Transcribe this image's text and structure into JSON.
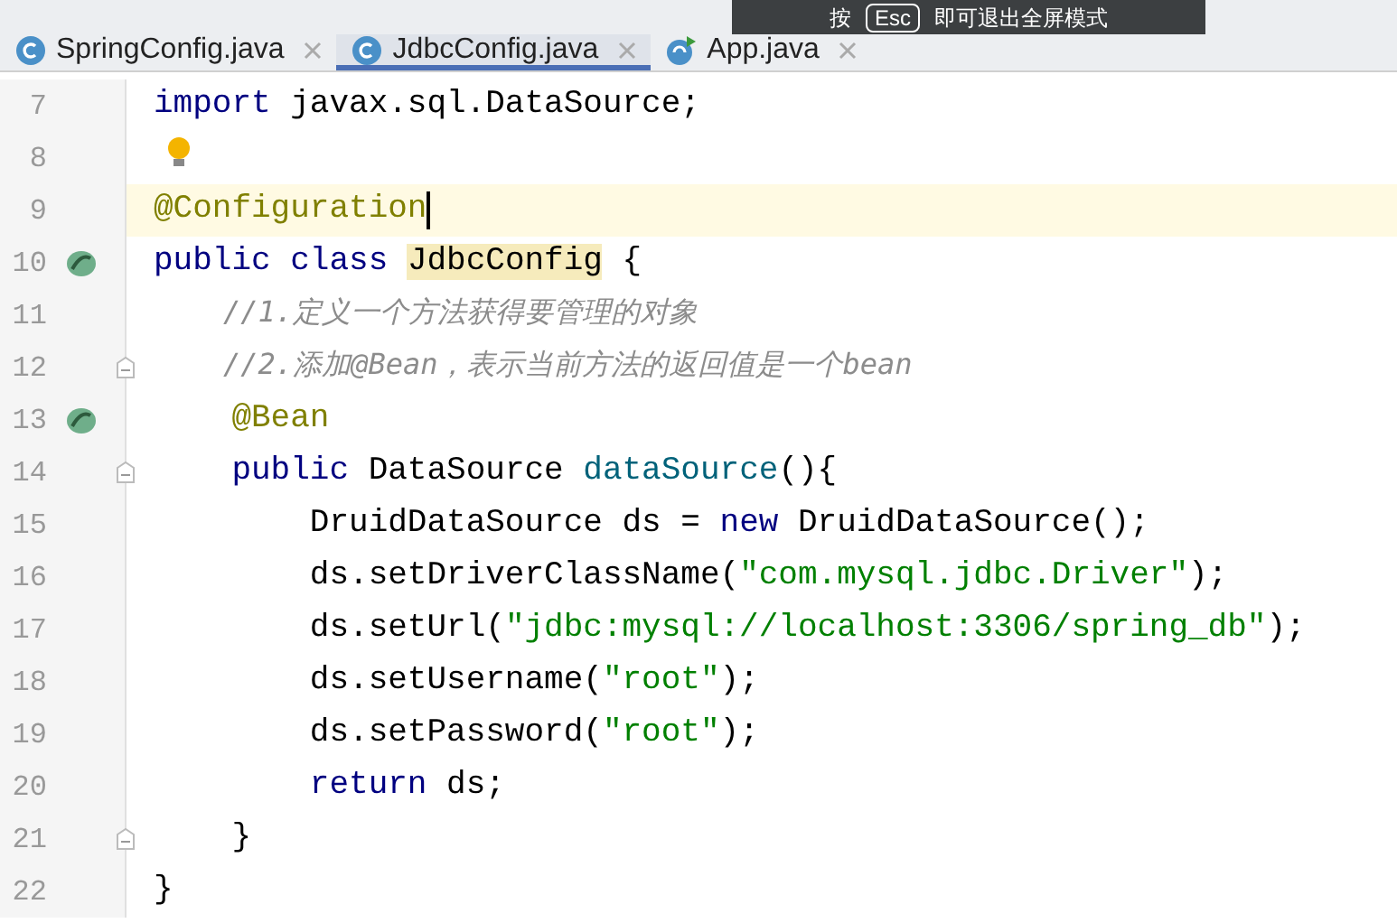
{
  "tabs": [
    {
      "label": "SpringConfig.java",
      "selected": false,
      "kind": "class"
    },
    {
      "label": "JdbcConfig.java",
      "selected": true,
      "kind": "class"
    },
    {
      "label": "App.java",
      "selected": false,
      "kind": "runnable"
    }
  ],
  "fullscreen_hint": {
    "before": "按",
    "key": "Esc",
    "after": "即可退出全屏模式"
  },
  "lines": [
    {
      "number": "7",
      "kind": "code",
      "tokens": [
        {
          "kind": "keyword",
          "text": "import"
        },
        {
          "kind": "plain",
          "text": " javax.sql.DataSource;"
        }
      ]
    },
    {
      "number": "8",
      "kind": "bulb"
    },
    {
      "number": "9",
      "kind": "code",
      "current": true,
      "caret": true,
      "tokens": [
        {
          "kind": "annotation",
          "text": "@Configuration"
        }
      ]
    },
    {
      "number": "10",
      "kind": "bean",
      "tokens": [
        {
          "kind": "keyword",
          "text": "public class "
        },
        {
          "kind": "highlight",
          "text": "JdbcConfig"
        },
        {
          "kind": "plain",
          "text": " {"
        }
      ]
    },
    {
      "number": "11",
      "kind": "code",
      "tokens": [
        {
          "kind": "comment",
          "text": "    //1.定义一个方法获得要管理的对象"
        }
      ]
    },
    {
      "number": "12",
      "kind": "code",
      "fold": true,
      "tokens": [
        {
          "kind": "comment",
          "text": "    //2.添加@Bean，表示当前方法的返回值是一个bean"
        }
      ]
    },
    {
      "number": "13",
      "kind": "bean",
      "tokens": [
        {
          "kind": "annotation",
          "text": "    @Bean"
        }
      ]
    },
    {
      "number": "14",
      "kind": "code",
      "fold": true,
      "tokens": [
        {
          "kind": "keyword",
          "text": "    public"
        },
        {
          "kind": "plain",
          "text": " DataSource "
        },
        {
          "kind": "method",
          "text": "dataSource"
        },
        {
          "kind": "plain",
          "text": "(){"
        }
      ]
    },
    {
      "number": "15",
      "kind": "code",
      "tokens": [
        {
          "kind": "plain",
          "text": "        DruidDataSource ds = "
        },
        {
          "kind": "keyword",
          "text": "new"
        },
        {
          "kind": "plain",
          "text": " DruidDataSource();"
        }
      ]
    },
    {
      "number": "16",
      "kind": "code",
      "tokens": [
        {
          "kind": "plain",
          "text": "        ds.setDriverClassName("
        },
        {
          "kind": "string",
          "text": "\"com.mysql.jdbc.Driver\""
        },
        {
          "kind": "plain",
          "text": ");"
        }
      ]
    },
    {
      "number": "17",
      "kind": "code",
      "tokens": [
        {
          "kind": "plain",
          "text": "        ds.setUrl("
        },
        {
          "kind": "string",
          "text": "\"jdbc:mysql://localhost:3306/spring_db\""
        },
        {
          "kind": "plain",
          "text": ");"
        }
      ]
    },
    {
      "number": "18",
      "kind": "code",
      "tokens": [
        {
          "kind": "plain",
          "text": "        ds.setUsername("
        },
        {
          "kind": "string",
          "text": "\"root\""
        },
        {
          "kind": "plain",
          "text": ");"
        }
      ]
    },
    {
      "number": "19",
      "kind": "code",
      "tokens": [
        {
          "kind": "plain",
          "text": "        ds.setPassword("
        },
        {
          "kind": "string",
          "text": "\"root\""
        },
        {
          "kind": "plain",
          "text": ");"
        }
      ]
    },
    {
      "number": "20",
      "kind": "code",
      "tokens": [
        {
          "kind": "keyword",
          "text": "        return"
        },
        {
          "kind": "plain",
          "text": " ds;"
        }
      ]
    },
    {
      "number": "21",
      "kind": "code",
      "fold": true,
      "tokens": [
        {
          "kind": "plain",
          "text": "    }"
        }
      ]
    },
    {
      "number": "22",
      "kind": "code",
      "tokens": [
        {
          "kind": "plain",
          "text": "}"
        }
      ]
    }
  ]
}
